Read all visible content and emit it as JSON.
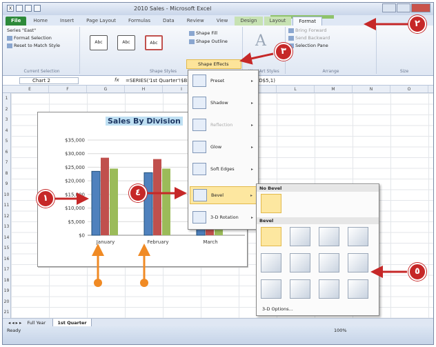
{
  "window": {
    "title": "2010 Sales - Microsoft Excel"
  },
  "tabs": [
    "File",
    "Home",
    "Insert",
    "Page Layout",
    "Formulas",
    "Data",
    "Review",
    "View",
    "Design",
    "Layout",
    "Format"
  ],
  "ribbon": {
    "current_selection": {
      "series": "Series \"East\"",
      "format_selection": "Format Selection",
      "reset": "Reset to Match Style",
      "label": "Current Selection"
    },
    "shape_styles": {
      "abc": [
        "Abc",
        "Abc",
        "Abc"
      ],
      "fill": "Shape Fill",
      "outline": "Shape Outline",
      "effects": "Shape Effects",
      "label": "Shape Styles"
    },
    "wordart": {
      "label": "WordArt Styles"
    },
    "arrange": {
      "bring_forward": "Bring Forward",
      "send_backward": "Send Backward",
      "selection_pane": "Selection Pane",
      "label": "Arrange"
    },
    "size": {
      "label": "Size"
    }
  },
  "formula_bar": {
    "name_box": "Chart 2",
    "fx": "fx",
    "formula": "=SERIES('1st Quarter'!$B$2:$D$2,'1st Quarter'!$B$5:$D$5,1)"
  },
  "columns": [
    "E",
    "F",
    "G",
    "H",
    "I",
    "J",
    "K",
    "L",
    "M",
    "N",
    "O"
  ],
  "rows": [
    "1",
    "2",
    "3",
    "4",
    "5",
    "6",
    "7",
    "8",
    "9",
    "10",
    "11",
    "12",
    "13",
    "14",
    "15",
    "16",
    "17",
    "18",
    "19",
    "20",
    "21"
  ],
  "chart_data": {
    "type": "bar",
    "title": "Sales By Division",
    "categories": [
      "January",
      "February",
      "March"
    ],
    "series": [
      {
        "values": [
          23500,
          23000,
          23000
        ],
        "color": "#4f81bd"
      },
      {
        "values": [
          28500,
          28000,
          27000
        ],
        "color": "#c0504d"
      },
      {
        "values": [
          24500,
          24500,
          24000
        ],
        "color": "#9bbb59"
      }
    ],
    "yticks": [
      "$0",
      "$5,000",
      "$10,000",
      "$15,000",
      "$20,000",
      "$25,000",
      "$30,000",
      "$35,000"
    ],
    "ylim": [
      0,
      35000
    ]
  },
  "shape_effects_menu": {
    "header": "Shape Effects",
    "items": [
      {
        "label": "Preset",
        "disabled": false
      },
      {
        "label": "Shadow",
        "disabled": false
      },
      {
        "label": "Reflection",
        "disabled": true
      },
      {
        "label": "Glow",
        "disabled": false
      },
      {
        "label": "Soft Edges",
        "disabled": false
      },
      {
        "label": "Bevel",
        "disabled": false
      },
      {
        "label": "3-D Rotation",
        "disabled": false
      }
    ]
  },
  "bevel_panel": {
    "no_bevel": "No Bevel",
    "bevel": "Bevel",
    "options": "3-D Options..."
  },
  "sheets": {
    "nav": "◂ ◂ ▸ ▸",
    "tabs": [
      "Full Year",
      "1st Quarter"
    ]
  },
  "status": {
    "ready": "Ready",
    "zoom": "100%"
  },
  "callouts": [
    "١",
    "٢",
    "٣",
    "٤",
    "٥"
  ],
  "colors": {
    "callout": "#c62828",
    "callout_orange": "#f08a24",
    "file_tab": "#2d8a3a"
  }
}
